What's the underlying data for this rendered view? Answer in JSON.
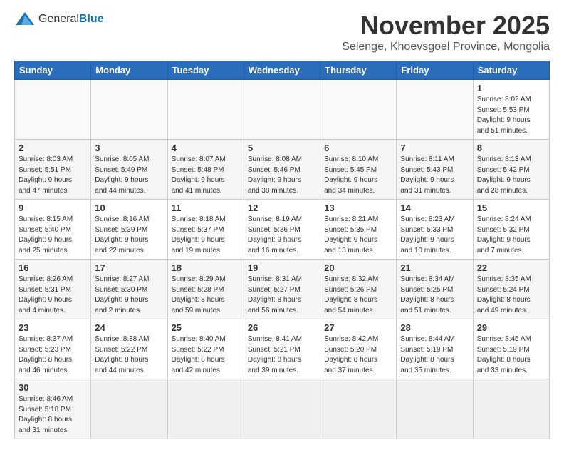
{
  "header": {
    "logo_general": "General",
    "logo_blue": "Blue",
    "title": "November 2025",
    "subtitle": "Selenge, Khoevsgoel Province, Mongolia"
  },
  "weekdays": [
    "Sunday",
    "Monday",
    "Tuesday",
    "Wednesday",
    "Thursday",
    "Friday",
    "Saturday"
  ],
  "weeks": [
    [
      {
        "day": "",
        "info": ""
      },
      {
        "day": "",
        "info": ""
      },
      {
        "day": "",
        "info": ""
      },
      {
        "day": "",
        "info": ""
      },
      {
        "day": "",
        "info": ""
      },
      {
        "day": "",
        "info": ""
      },
      {
        "day": "1",
        "info": "Sunrise: 8:02 AM\nSunset: 5:53 PM\nDaylight: 9 hours\nand 51 minutes."
      }
    ],
    [
      {
        "day": "2",
        "info": "Sunrise: 8:03 AM\nSunset: 5:51 PM\nDaylight: 9 hours\nand 47 minutes."
      },
      {
        "day": "3",
        "info": "Sunrise: 8:05 AM\nSunset: 5:49 PM\nDaylight: 9 hours\nand 44 minutes."
      },
      {
        "day": "4",
        "info": "Sunrise: 8:07 AM\nSunset: 5:48 PM\nDaylight: 9 hours\nand 41 minutes."
      },
      {
        "day": "5",
        "info": "Sunrise: 8:08 AM\nSunset: 5:46 PM\nDaylight: 9 hours\nand 38 minutes."
      },
      {
        "day": "6",
        "info": "Sunrise: 8:10 AM\nSunset: 5:45 PM\nDaylight: 9 hours\nand 34 minutes."
      },
      {
        "day": "7",
        "info": "Sunrise: 8:11 AM\nSunset: 5:43 PM\nDaylight: 9 hours\nand 31 minutes."
      },
      {
        "day": "8",
        "info": "Sunrise: 8:13 AM\nSunset: 5:42 PM\nDaylight: 9 hours\nand 28 minutes."
      }
    ],
    [
      {
        "day": "9",
        "info": "Sunrise: 8:15 AM\nSunset: 5:40 PM\nDaylight: 9 hours\nand 25 minutes."
      },
      {
        "day": "10",
        "info": "Sunrise: 8:16 AM\nSunset: 5:39 PM\nDaylight: 9 hours\nand 22 minutes."
      },
      {
        "day": "11",
        "info": "Sunrise: 8:18 AM\nSunset: 5:37 PM\nDaylight: 9 hours\nand 19 minutes."
      },
      {
        "day": "12",
        "info": "Sunrise: 8:19 AM\nSunset: 5:36 PM\nDaylight: 9 hours\nand 16 minutes."
      },
      {
        "day": "13",
        "info": "Sunrise: 8:21 AM\nSunset: 5:35 PM\nDaylight: 9 hours\nand 13 minutes."
      },
      {
        "day": "14",
        "info": "Sunrise: 8:23 AM\nSunset: 5:33 PM\nDaylight: 9 hours\nand 10 minutes."
      },
      {
        "day": "15",
        "info": "Sunrise: 8:24 AM\nSunset: 5:32 PM\nDaylight: 9 hours\nand 7 minutes."
      }
    ],
    [
      {
        "day": "16",
        "info": "Sunrise: 8:26 AM\nSunset: 5:31 PM\nDaylight: 9 hours\nand 4 minutes."
      },
      {
        "day": "17",
        "info": "Sunrise: 8:27 AM\nSunset: 5:30 PM\nDaylight: 9 hours\nand 2 minutes."
      },
      {
        "day": "18",
        "info": "Sunrise: 8:29 AM\nSunset: 5:28 PM\nDaylight: 8 hours\nand 59 minutes."
      },
      {
        "day": "19",
        "info": "Sunrise: 8:31 AM\nSunset: 5:27 PM\nDaylight: 8 hours\nand 56 minutes."
      },
      {
        "day": "20",
        "info": "Sunrise: 8:32 AM\nSunset: 5:26 PM\nDaylight: 8 hours\nand 54 minutes."
      },
      {
        "day": "21",
        "info": "Sunrise: 8:34 AM\nSunset: 5:25 PM\nDaylight: 8 hours\nand 51 minutes."
      },
      {
        "day": "22",
        "info": "Sunrise: 8:35 AM\nSunset: 5:24 PM\nDaylight: 8 hours\nand 49 minutes."
      }
    ],
    [
      {
        "day": "23",
        "info": "Sunrise: 8:37 AM\nSunset: 5:23 PM\nDaylight: 8 hours\nand 46 minutes."
      },
      {
        "day": "24",
        "info": "Sunrise: 8:38 AM\nSunset: 5:22 PM\nDaylight: 8 hours\nand 44 minutes."
      },
      {
        "day": "25",
        "info": "Sunrise: 8:40 AM\nSunset: 5:22 PM\nDaylight: 8 hours\nand 42 minutes."
      },
      {
        "day": "26",
        "info": "Sunrise: 8:41 AM\nSunset: 5:21 PM\nDaylight: 8 hours\nand 39 minutes."
      },
      {
        "day": "27",
        "info": "Sunrise: 8:42 AM\nSunset: 5:20 PM\nDaylight: 8 hours\nand 37 minutes."
      },
      {
        "day": "28",
        "info": "Sunrise: 8:44 AM\nSunset: 5:19 PM\nDaylight: 8 hours\nand 35 minutes."
      },
      {
        "day": "29",
        "info": "Sunrise: 8:45 AM\nSunset: 5:19 PM\nDaylight: 8 hours\nand 33 minutes."
      }
    ],
    [
      {
        "day": "30",
        "info": "Sunrise: 8:46 AM\nSunset: 5:18 PM\nDaylight: 8 hours\nand 31 minutes."
      },
      {
        "day": "",
        "info": ""
      },
      {
        "day": "",
        "info": ""
      },
      {
        "day": "",
        "info": ""
      },
      {
        "day": "",
        "info": ""
      },
      {
        "day": "",
        "info": ""
      },
      {
        "day": "",
        "info": ""
      }
    ]
  ]
}
